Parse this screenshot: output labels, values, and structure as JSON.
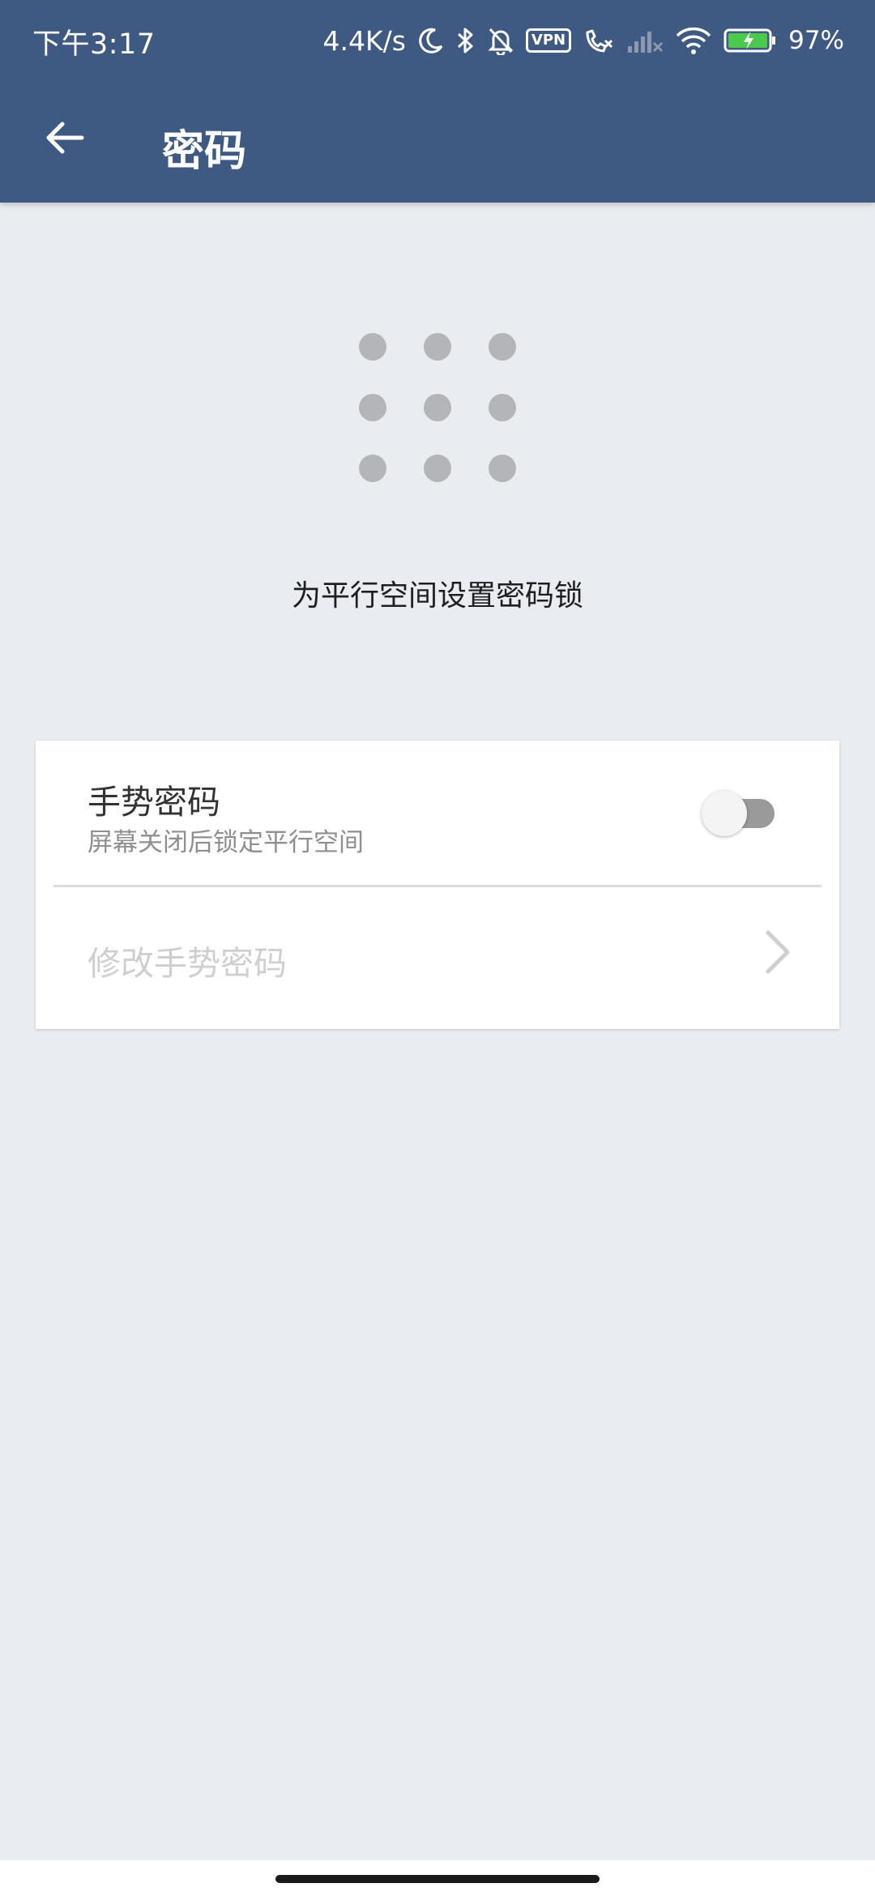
{
  "status_bar": {
    "time": "下午3:17",
    "net_speed": "4.4K/s",
    "vpn_label": "VPN",
    "battery": "97%",
    "icons": [
      "moon-icon",
      "bluetooth-icon",
      "bell-off-icon",
      "vpn-icon",
      "call-x-icon",
      "signal-x-icon",
      "wifi-icon",
      "battery-charging-icon"
    ]
  },
  "toolbar": {
    "title": "密码",
    "back_icon": "arrow-left-icon",
    "background": "#3f5a82"
  },
  "hero": {
    "icon": "pattern-lock-icon",
    "headline": "为平行空间设置密码锁"
  },
  "settings": {
    "gesture": {
      "title": "手势密码",
      "subtitle": "屏幕关闭后锁定平行空间",
      "enabled": false
    },
    "change": {
      "label": "修改手势密码",
      "icon": "chevron-right-icon"
    }
  },
  "colors": {
    "page_background": "#e9ecf0",
    "card_background": "#ffffff",
    "disabled_text": "#cfcfcf"
  }
}
